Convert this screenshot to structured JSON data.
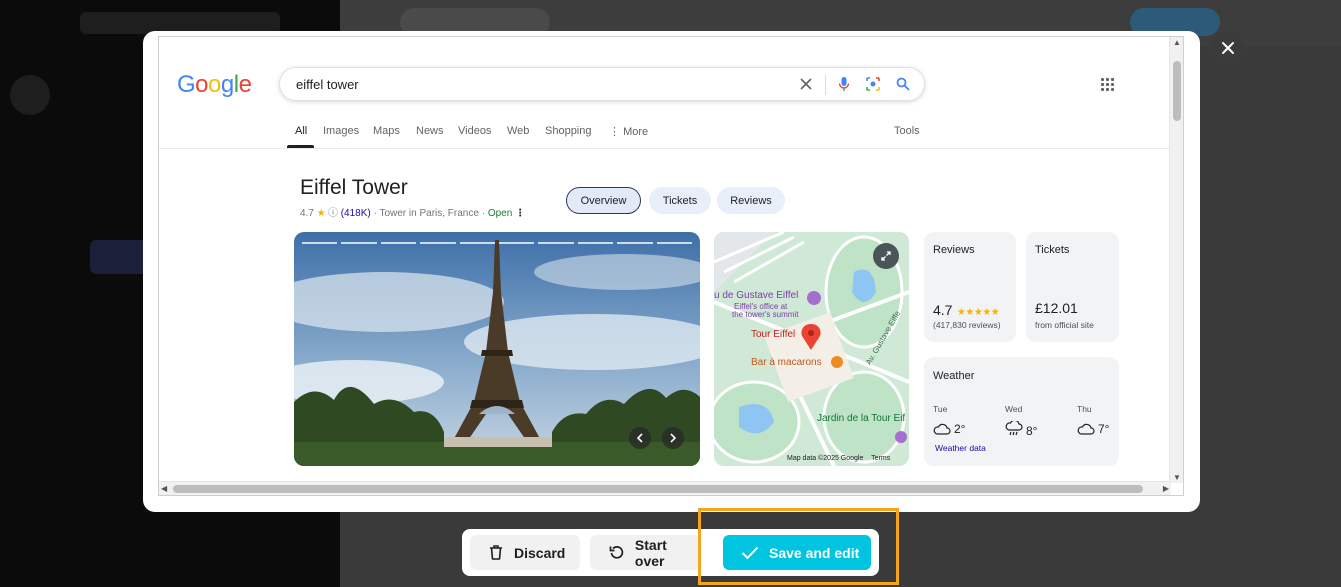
{
  "search": {
    "query": "eiffel tower",
    "tabs": [
      "All",
      "Images",
      "Maps",
      "News",
      "Videos",
      "Web",
      "Shopping",
      "More"
    ],
    "tools_label": "Tools"
  },
  "logo": {
    "letters": [
      "G",
      "o",
      "o",
      "g",
      "l",
      "e"
    ]
  },
  "panel": {
    "title": "Eiffel Tower",
    "rating": "4.7",
    "rating_count": "(418K)",
    "subtitle": "· Tower in Paris, France ·",
    "open_status": "Open",
    "chips": [
      "Overview",
      "Tickets",
      "Reviews"
    ]
  },
  "map": {
    "label_museum": "u de Gustave Eiffel",
    "label_office1": "Eiffel's office at",
    "label_office2": "the tower's summit",
    "label_tower": "Tour Eiffel",
    "label_bar": "Bar à macarons",
    "label_avenue": "Av. Gustave Eiffe",
    "label_garden": "Jardin de la Tour Eif",
    "attribution": "Map data ©2025 Google",
    "terms": "Terms"
  },
  "reviews_card": {
    "title": "Reviews",
    "rating": "4.7",
    "count": "(417,830 reviews)"
  },
  "tickets_card": {
    "title": "Tickets",
    "price": "£12.01",
    "source": "from official site"
  },
  "weather_card": {
    "title": "Weather",
    "days": [
      {
        "day": "Tue",
        "temp": "2°",
        "icon": "cloud-icon"
      },
      {
        "day": "Wed",
        "temp": "8°",
        "icon": "rain-cloud-icon"
      },
      {
        "day": "Thu",
        "temp": "7°",
        "icon": "cloud-icon"
      }
    ],
    "link": "Weather data"
  },
  "actions": {
    "discard": "Discard",
    "start_over": "Start over",
    "save_and_edit": "Save and edit"
  },
  "colors": {
    "accent": "#00c4e0",
    "highlight": "#f5a51b",
    "google_blue": "#4285F4",
    "google_red": "#EA4335",
    "google_yellow": "#FBBC05",
    "google_green": "#34A853"
  }
}
